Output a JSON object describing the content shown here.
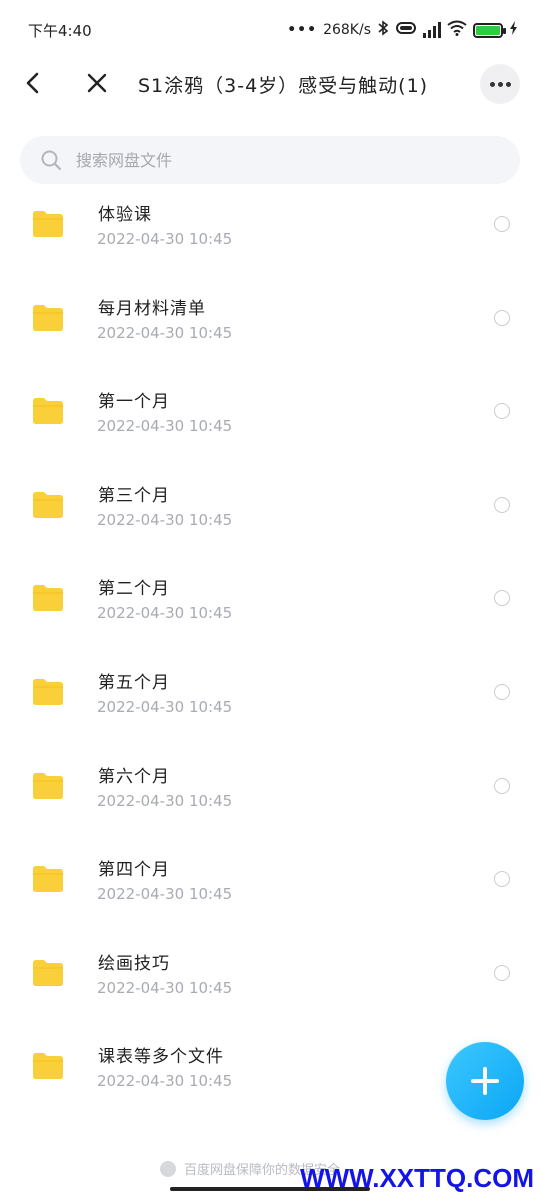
{
  "status_bar": {
    "time": "下午4:40",
    "net_speed": "268K/s",
    "icons": [
      "dots-icon",
      "bluetooth-icon",
      "vibrate-icon",
      "hd-signal-icon",
      "wifi-icon",
      "battery-icon",
      "charging-icon"
    ]
  },
  "header": {
    "title": "S1涂鸦（3-4岁）感受与触动(1)"
  },
  "search": {
    "placeholder": "搜索网盘文件"
  },
  "files": [
    {
      "name": "体验课",
      "date": "2022-04-30  10:45"
    },
    {
      "name": "每月材料清单",
      "date": "2022-04-30  10:45"
    },
    {
      "name": "第一个月",
      "date": "2022-04-30  10:45"
    },
    {
      "name": "第三个月",
      "date": "2022-04-30  10:45"
    },
    {
      "name": "第二个月",
      "date": "2022-04-30  10:45"
    },
    {
      "name": "第五个月",
      "date": "2022-04-30  10:45"
    },
    {
      "name": "第六个月",
      "date": "2022-04-30  10:45"
    },
    {
      "name": "第四个月",
      "date": "2022-04-30  10:45"
    },
    {
      "name": "绘画技巧",
      "date": "2022-04-30  10:45"
    },
    {
      "name": "课表等多个文件",
      "date": "2022-04-30  10:45"
    }
  ],
  "footer": {
    "note": "百度网盘保障你的数据安全"
  },
  "watermark": "WWW.XXTTQ.COM",
  "colors": {
    "folder": "#f9cf3a",
    "fab": "#0aa6f5",
    "watermark": "#1414e6"
  }
}
